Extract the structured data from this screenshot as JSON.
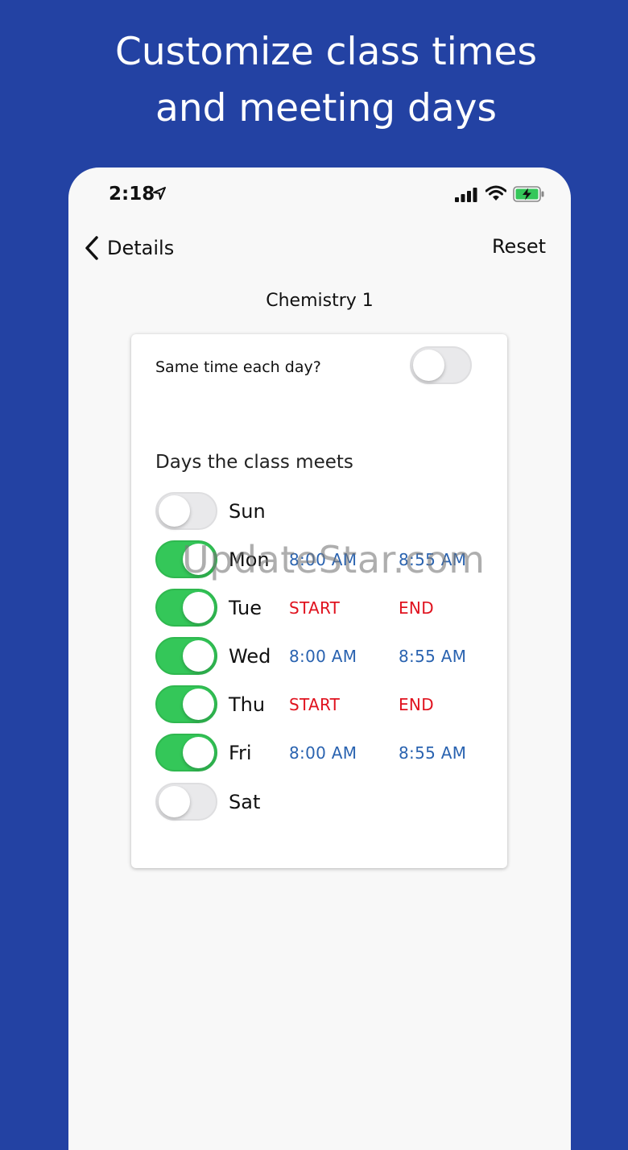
{
  "headline": {
    "line1": "Customize class times",
    "line2": "and meeting days"
  },
  "status_bar": {
    "time": "2:18"
  },
  "nav": {
    "back_label": "Details",
    "reset_label": "Reset"
  },
  "page_title": "Chemistry 1",
  "settings": {
    "same_time_label": "Same time each day?",
    "same_time_on": false
  },
  "days_label": "Days the class meets",
  "days": [
    {
      "name": "Sun",
      "on": false,
      "start": "",
      "end": ""
    },
    {
      "name": "Mon",
      "on": true,
      "start": "8:00 AM",
      "end": "8:55 AM"
    },
    {
      "name": "Tue",
      "on": true,
      "start": "START",
      "end": "END"
    },
    {
      "name": "Wed",
      "on": true,
      "start": "8:00 AM",
      "end": "8:55 AM"
    },
    {
      "name": "Thu",
      "on": true,
      "start": "START",
      "end": "END"
    },
    {
      "name": "Fri",
      "on": true,
      "start": "8:00 AM",
      "end": "8:55 AM"
    },
    {
      "name": "Sat",
      "on": false,
      "start": "",
      "end": ""
    }
  ],
  "watermark": "UpdateStar.com",
  "colors": {
    "background": "#2342a3",
    "toggle_on": "#34c759",
    "time_set": "#2a63b0",
    "time_unset": "#e0121e"
  }
}
